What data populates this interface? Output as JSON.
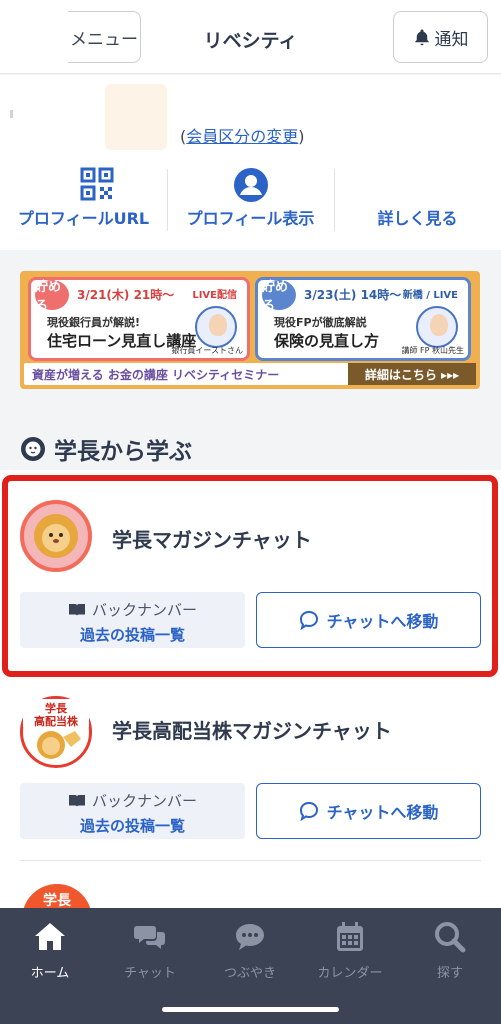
{
  "header": {
    "menu_label": "メニュー",
    "title": "リベシティ",
    "notify_label": "通知"
  },
  "profile": {
    "member_prefix": "(",
    "member_link": "会員区分の変更",
    "member_suffix": ")",
    "actions": [
      {
        "label": "プロフィールURL",
        "icon": "qr-code-icon"
      },
      {
        "label": "プロフィール表示",
        "icon": "user-circle-icon"
      },
      {
        "label": "詳しく見る",
        "icon": ""
      }
    ]
  },
  "banner": {
    "left": {
      "badge": "貯める",
      "date": "3/21(木) 21時〜",
      "tag": "LIVE配信",
      "sub": "現役銀行員が解説!",
      "main": "住宅ローン見直し講座",
      "person": "銀行員イーストさん"
    },
    "right": {
      "badge": "貯める",
      "date": "3/23(土) 14時〜",
      "tag": "新橋 / LIVE",
      "sub": "現役FPが徹底解説",
      "main": "保険の見直し方",
      "person": "講師 FP 秋山先生"
    },
    "bottom_text": "資産が増える お金の講座 リベシティセミナー",
    "detail_label": "詳細はこちら ▸▸▸"
  },
  "section": {
    "title": "学長から学ぶ"
  },
  "chats": [
    {
      "name": "学長マガジンチャット",
      "back_label": "バックナンバー",
      "back_link": "過去の投稿一覧",
      "go_label": "チャットへ移動"
    },
    {
      "name": "学長高配当株マガジンチャット",
      "avatar_text": "学長\n高配当株",
      "back_label": "バックナンバー",
      "back_link": "過去の投稿一覧",
      "go_label": "チャットへ移動"
    }
  ],
  "peek_card": {
    "avatar_text": "学長"
  },
  "nav": {
    "items": [
      {
        "label": "ホーム",
        "icon": "home-icon",
        "active": true
      },
      {
        "label": "チャット",
        "icon": "chat-bubbles-icon",
        "active": false
      },
      {
        "label": "つぶやき",
        "icon": "tweet-bubble-icon",
        "active": false
      },
      {
        "label": "カレンダー",
        "icon": "calendar-icon",
        "active": false
      },
      {
        "label": "探す",
        "icon": "search-icon",
        "active": false
      }
    ]
  },
  "colors": {
    "accent": "#2b63c6",
    "nav_bg": "#3b4354",
    "highlight": "#e0211b"
  }
}
